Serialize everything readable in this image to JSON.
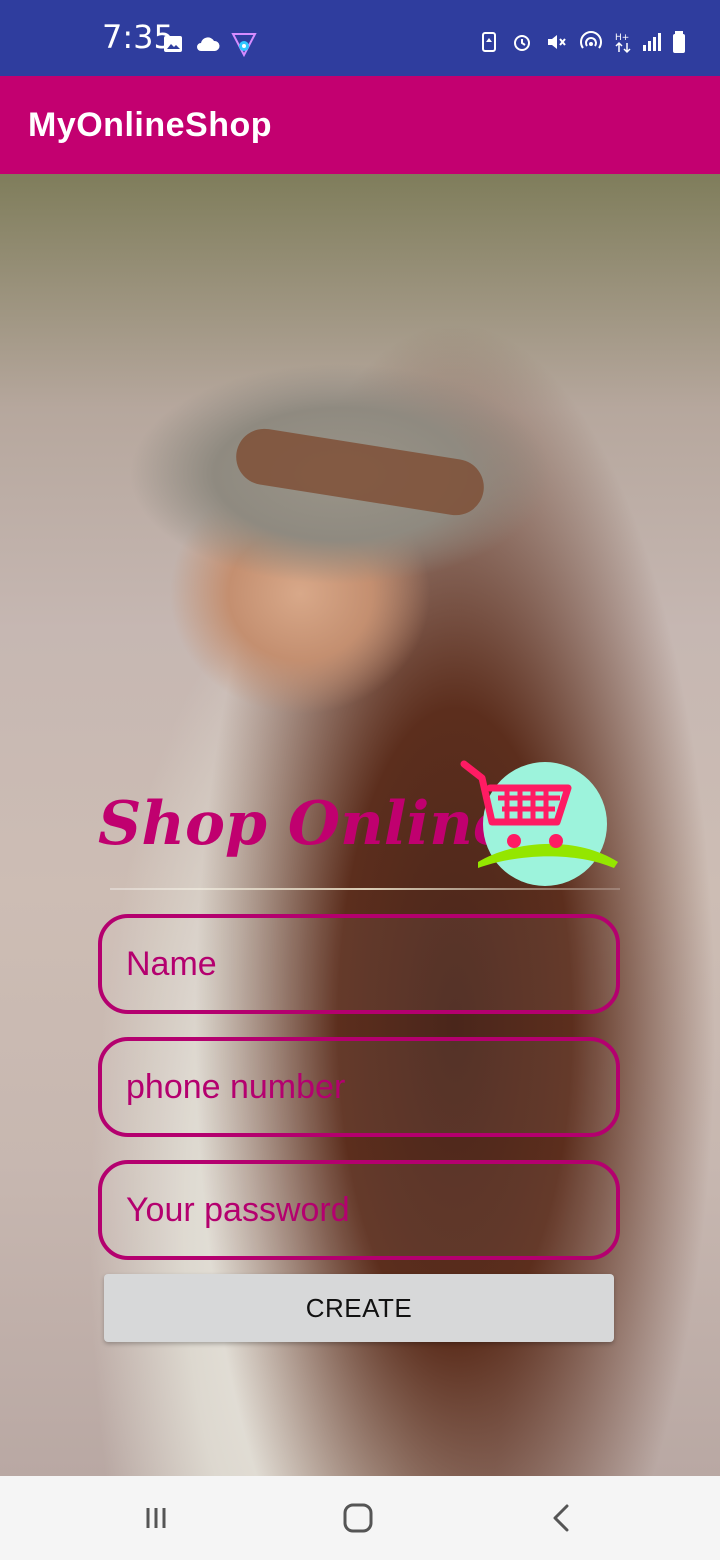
{
  "status_bar": {
    "time": "7:35",
    "left_icons": [
      "image-icon",
      "cloud-icon",
      "app-notification-icon"
    ],
    "right_icons": [
      "battery-saver-icon",
      "alarm-icon",
      "mute-icon",
      "hotspot-icon",
      "hplus-data-icon",
      "signal-icon",
      "battery-icon"
    ]
  },
  "app_bar": {
    "title": "MyOnlineShop"
  },
  "hero": {
    "title": "Shop Online"
  },
  "form": {
    "name_placeholder": "Name",
    "phone_placeholder": "phone number",
    "password_placeholder": "Your password",
    "name_value": "",
    "phone_value": "",
    "password_value": "",
    "create_label": "CREATE"
  },
  "navigation": [
    "recent-apps-icon",
    "home-icon",
    "back-icon"
  ],
  "colors": {
    "status_bar": "#2f3d9e",
    "app_bar": "#c30070",
    "accent": "#b4006f",
    "button": "#d7d8d9",
    "nav_bar": "#f5f5f5"
  }
}
